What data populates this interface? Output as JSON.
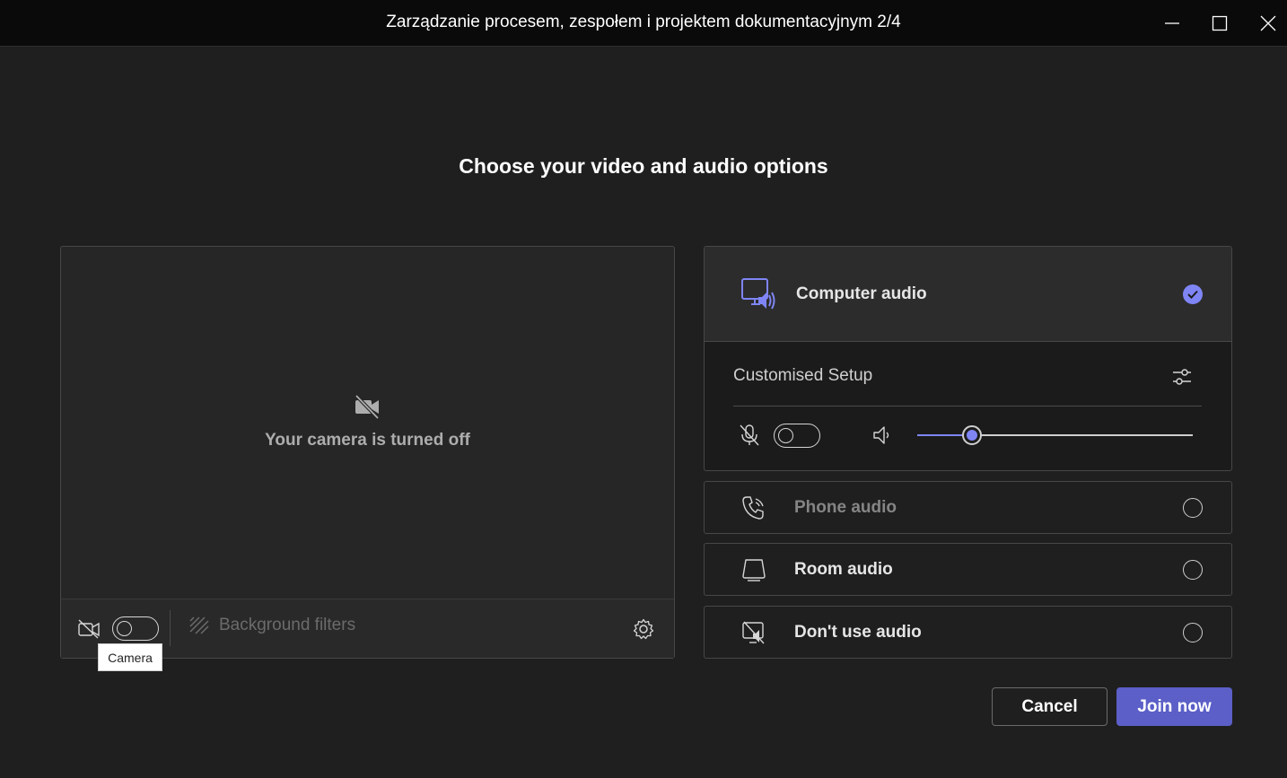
{
  "window": {
    "title": "Zarządzanie procesem, zespołem i projektem dokumentacyjnym 2/4",
    "buttons": [
      "minimize-icon",
      "maximize-icon",
      "close-icon"
    ]
  },
  "heading": "Choose your video and audio options",
  "video": {
    "camera_off_text": "Your camera is turned off",
    "camera_toggle_on": false,
    "background_filters_label": "Background filters",
    "tooltip": "Camera"
  },
  "audio": {
    "computer_audio": {
      "label": "Computer audio",
      "selected": true,
      "customised_setup_label": "Customised Setup",
      "mic_toggle_on": false,
      "speaker_volume": 0.2
    },
    "options": [
      {
        "label": "Phone audio",
        "icon": "phone-audio-icon",
        "selected": false,
        "dimmed": true
      },
      {
        "label": "Room audio",
        "icon": "room-audio-icon",
        "selected": false,
        "dimmed": false
      },
      {
        "label": "Don't use audio",
        "icon": "no-audio-icon",
        "selected": false,
        "dimmed": false
      }
    ]
  },
  "actions": {
    "cancel": "Cancel",
    "join": "Join now"
  },
  "colors": {
    "accent": "#7f85f5",
    "primary_button": "#5b5fc7",
    "background": "#1f1f1f"
  }
}
